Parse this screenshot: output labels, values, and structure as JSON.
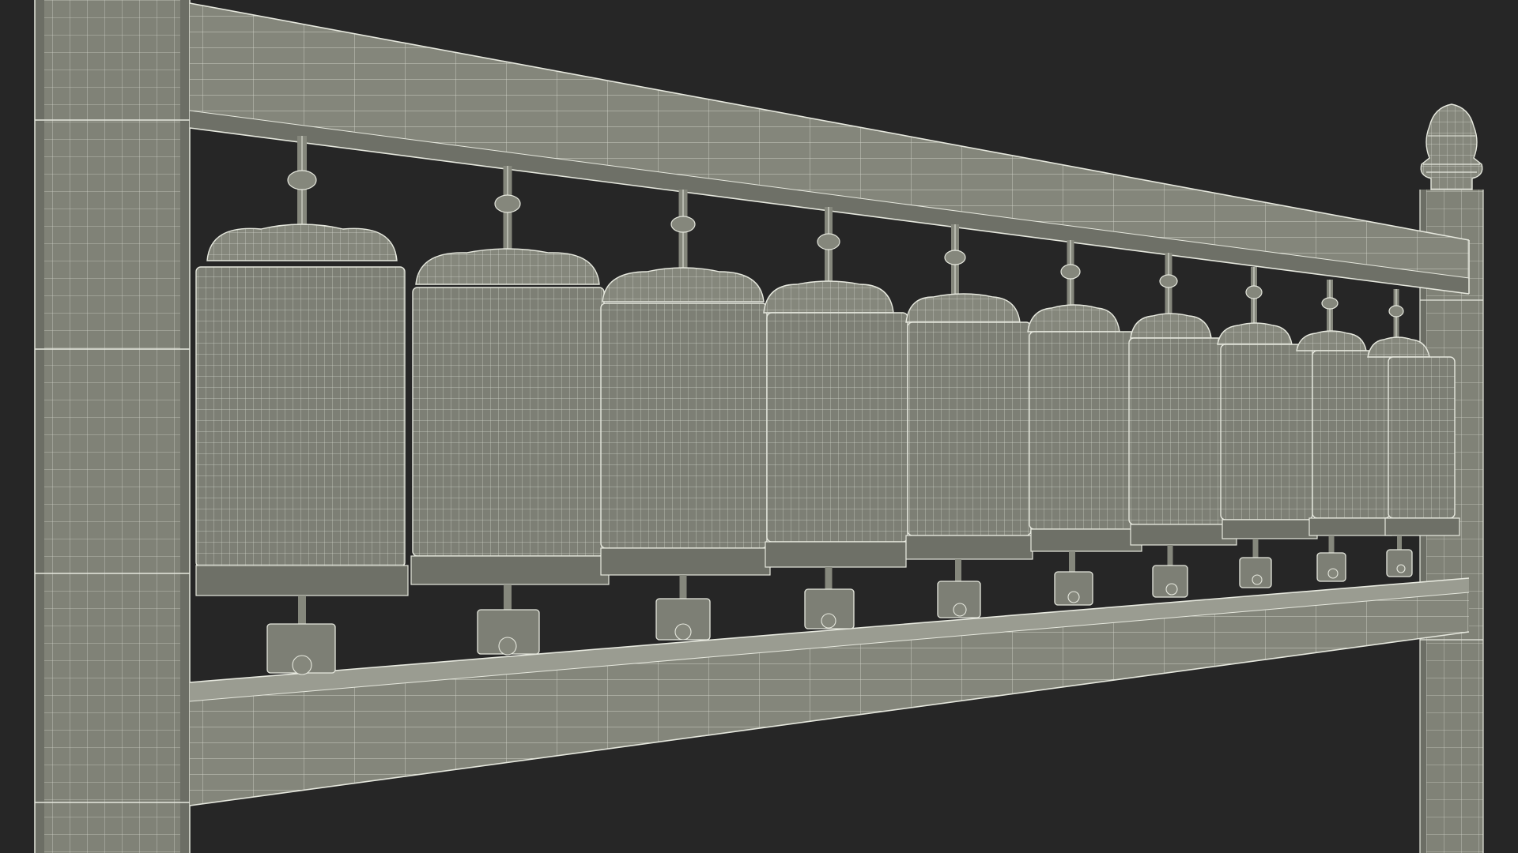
{
  "scene": {
    "subject": "wireframe-prayer-wheel-rack",
    "wheel_count": 10
  },
  "colors": {
    "background": "#262626",
    "surface": "#85877c",
    "surface_shade": "#75776d",
    "surface_dark": "#5f6159",
    "wire": "#e6e8de",
    "wire_dim": "#c9cbc1",
    "outline": "#3a3b36"
  }
}
